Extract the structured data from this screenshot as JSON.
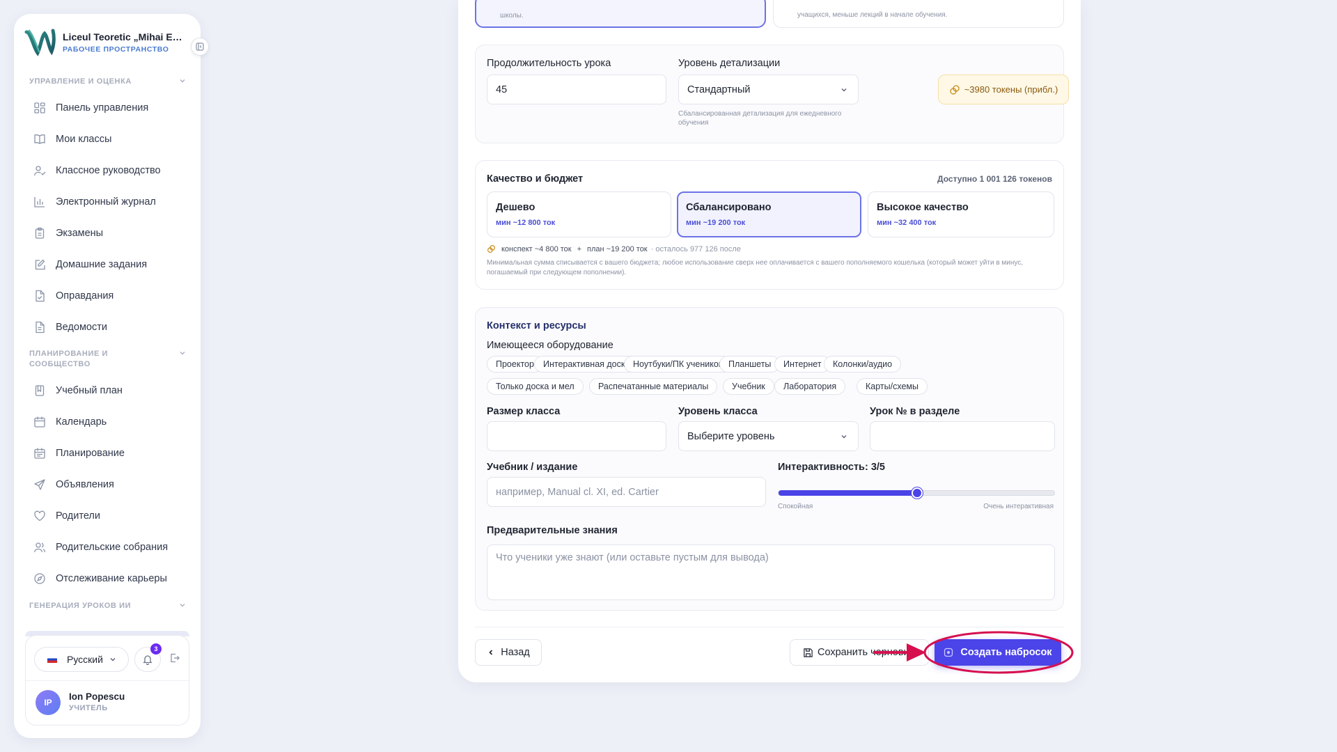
{
  "sidebar": {
    "brand_name": "Liceul Teoretic „Mihai Emi...",
    "brand_sub": "РАБОЧЕЕ ПРОСТРАНСТВО",
    "sections": [
      {
        "label": "УПРАВЛЕНИЕ И ОЦЕНКА"
      },
      {
        "label": "ПЛАНИРОВАНИЕ И СООБЩЕСТВО"
      },
      {
        "label": "ГЕНЕРАЦИЯ УРОКОВ ИИ"
      }
    ],
    "items": [
      {
        "label": "Панель управления",
        "icon": "dashboard-icon"
      },
      {
        "label": "Мои классы",
        "icon": "book-icon"
      },
      {
        "label": "Классное руководство",
        "icon": "user-check-icon"
      },
      {
        "label": "Электронный журнал",
        "icon": "bar-chart-icon"
      },
      {
        "label": "Экзамены",
        "icon": "clipboard-icon"
      },
      {
        "label": "Домашние задания",
        "icon": "edit-icon"
      },
      {
        "label": "Оправдания",
        "icon": "file-check-icon"
      },
      {
        "label": "Ведомости",
        "icon": "file-text-icon"
      },
      {
        "label": "Учебный план",
        "icon": "book-open-icon"
      },
      {
        "label": "Календарь",
        "icon": "calendar-icon"
      },
      {
        "label": "Планирование",
        "icon": "calendar-plan-icon"
      },
      {
        "label": "Объявления",
        "icon": "send-icon"
      },
      {
        "label": "Родители",
        "icon": "heart-icon"
      },
      {
        "label": "Родительские собрания",
        "icon": "users-icon"
      },
      {
        "label": "Отслеживание карьеры",
        "icon": "compass-icon"
      }
    ],
    "language": "Русский",
    "notifications_count": "3",
    "user": {
      "initials": "IP",
      "name": "Ion Popescu",
      "role": "УЧИТЕЛЬ"
    }
  },
  "top_options": {
    "left_text": "школы.",
    "right_text": "учащихся, меньше лекций в начале обучения."
  },
  "lesson": {
    "duration_label": "Продолжительность урока",
    "duration_value": "45",
    "detail_label": "Уровень детализации",
    "detail_value": "Стандартный",
    "detail_hint": "Сбалансированная детализация для ежедневного обучения",
    "tokens_estimate": "~3980 токены (прибл.)"
  },
  "quality": {
    "title": "Качество и бюджет",
    "available": "Доступно 1 001 126 токенов",
    "options": [
      {
        "title": "Дешево",
        "sub": "мин ~12 800 ток"
      },
      {
        "title": "Сбалансировано",
        "sub": "мин ~19 200 ток"
      },
      {
        "title": "Высокое качество",
        "sub": "мин ~32 400 ток"
      }
    ],
    "selected": "Сбалансировано",
    "breakdown_outline": "конспект ~4 800 ток",
    "breakdown_plus": "+",
    "breakdown_plan": "план ~19 200 ток",
    "breakdown_left": "· осталось 977 126 после",
    "note": "Минимальная сумма списывается с вашего бюджета; любое использование сверх нее оплачивается с вашего пополняемого кошелька (который может уйти в минус, погашаемый при следующем пополнении)."
  },
  "context": {
    "title": "Контекст и ресурсы",
    "equipment_label": "Имеющееся оборудование",
    "equipment": [
      "Проектор",
      "Интерактивная доска",
      "Ноутбуки/ПК учеников",
      "Планшеты",
      "Интернет",
      "Колонки/аудио",
      "Только доска и мел",
      "Распечатанные материалы",
      "Учебник",
      "Лаборатория",
      "Карты/схемы"
    ],
    "class_size_label": "Размер класса",
    "class_size_value": "",
    "class_level_label": "Уровень класса",
    "class_level_value": "Выберите уровень",
    "lesson_no_label": "Урок № в разделе",
    "lesson_no_value": "",
    "textbook_label": "Учебник / издание",
    "textbook_placeholder": "например, Manual cl. XI, ed. Cartier",
    "interactivity_label": "Интерактивность: 3/5",
    "interactivity_value": 3,
    "interactivity_max": 5,
    "interactivity_min_label": "Спокойная",
    "interactivity_max_label": "Очень интерактивная",
    "prior_label": "Предварительные знания",
    "prior_placeholder": "Что ученики уже знают (или оставьте пустым для вывода)"
  },
  "actions": {
    "back": "Назад",
    "save_draft": "Сохранить черновик",
    "create": "Создать набросок"
  },
  "colors": {
    "accent": "#4b44e8",
    "highlight": "#d6104f"
  }
}
